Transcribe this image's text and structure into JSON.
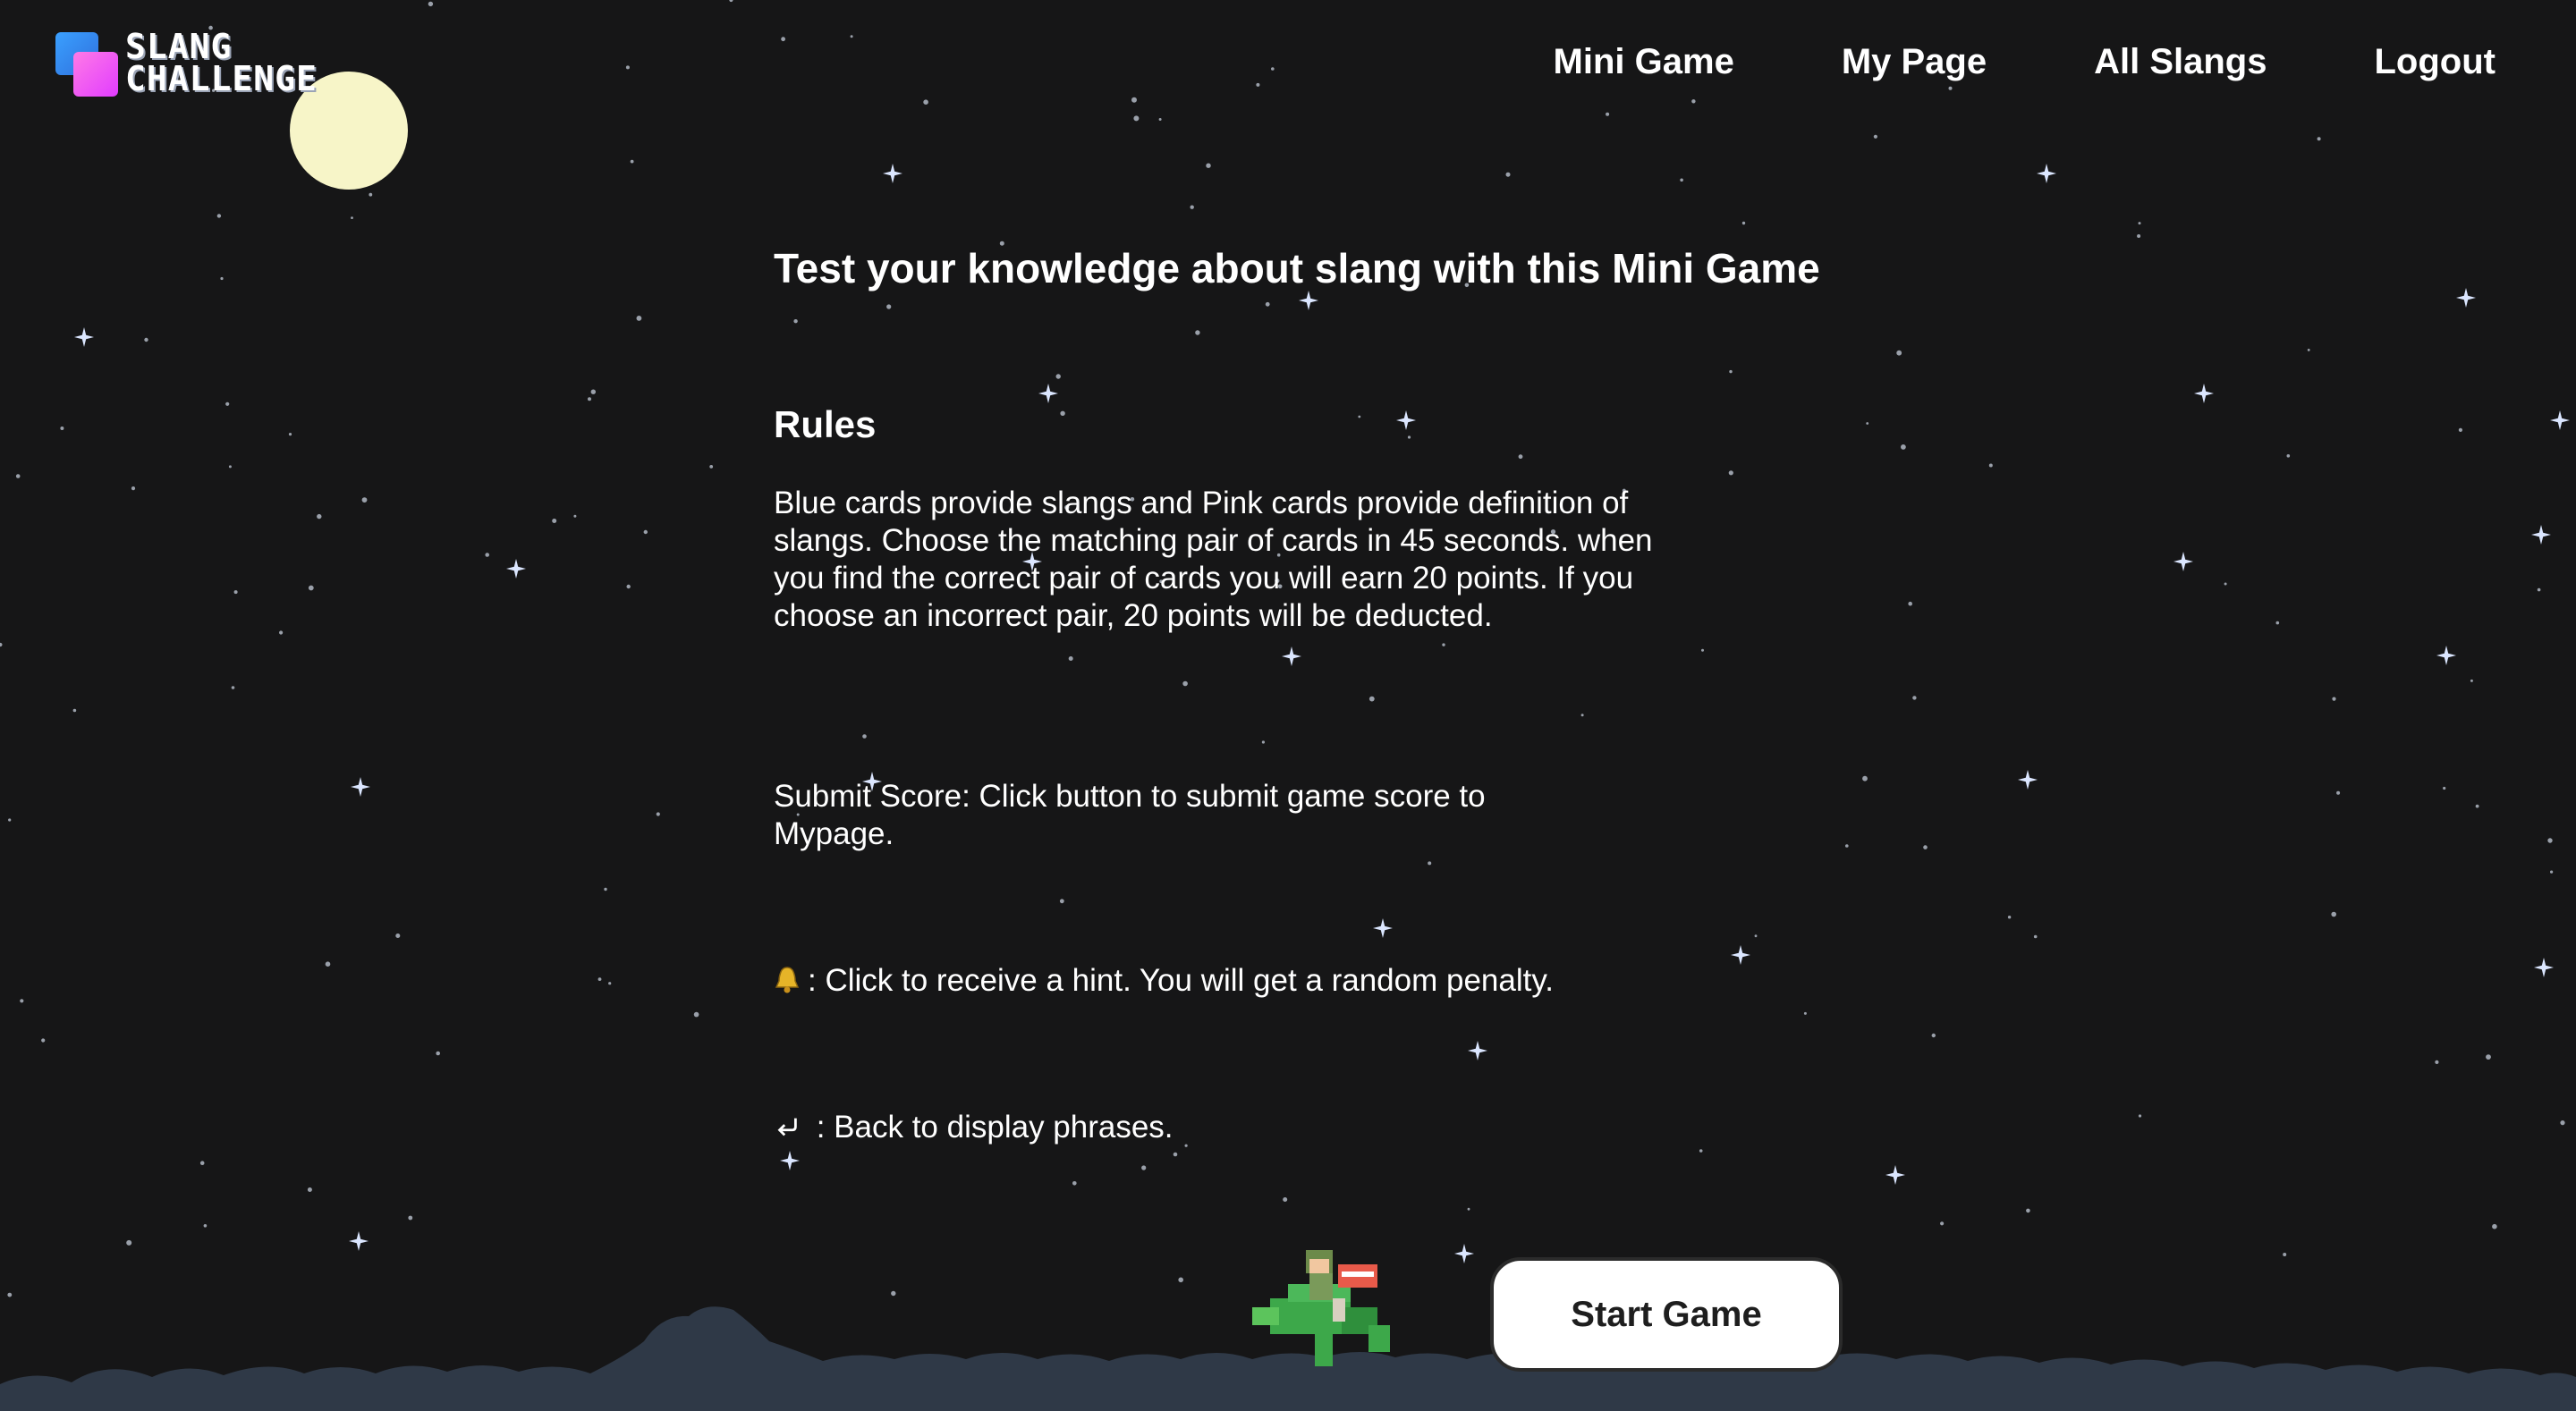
{
  "brand": {
    "logo_text_line1": "SLANG",
    "logo_text_line2": "CHALLENGE",
    "logo_colors": [
      "#3aa0ff",
      "#e13cff"
    ]
  },
  "nav": {
    "items": [
      {
        "label": "Mini Game"
      },
      {
        "label": "My Page"
      },
      {
        "label": "All Slangs"
      },
      {
        "label": "Logout"
      }
    ]
  },
  "main": {
    "title": "Test your knowledge about slang with this Mini Game",
    "rules_heading": "Rules",
    "rules_text": "Blue cards provide slangs and Pink cards provide definition of slangs. Choose the matching pair of cards in 45 seconds. when you find the correct pair of cards you will earn 20 points. If you choose an incorrect pair, 20 points will be deducted.",
    "submit_text": "Submit Score: Click button to submit game score to Mypage.",
    "hint_text": ": Click to receive a hint. You will get a random penalty.",
    "back_text": " : Back to display phrases.",
    "hint_icon": "bell-icon",
    "back_icon": "return-arrow-icon"
  },
  "start_button": {
    "label": "Start Game"
  },
  "theme": {
    "background": "#161617",
    "moon": "#f7f5c8",
    "clouds": "#2f3947"
  }
}
